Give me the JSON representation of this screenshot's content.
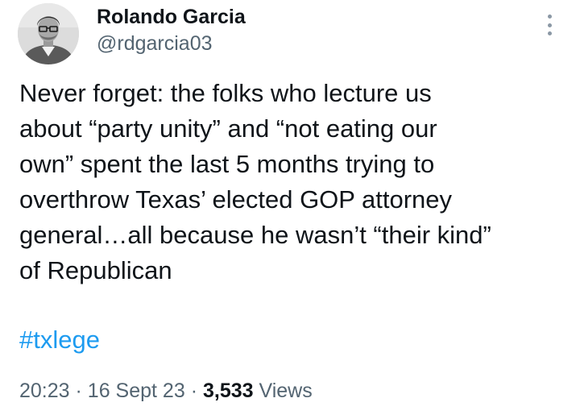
{
  "author": {
    "display_name": "Rolando Garcia",
    "handle": "@rdgarcia03",
    "avatar_icon": "user-avatar-photo"
  },
  "more_icon": "vertical-ellipsis-icon",
  "tweet": {
    "text_lines": [
      "Never forget: the folks who lecture us",
      "about “party unity” and “not eating our",
      "own” spent the last 5 months trying to",
      "overthrow Texas’ elected GOP attorney",
      "general…all because he wasn’t “their kind”",
      "of Republican"
    ],
    "hashtag": "#txlege"
  },
  "meta": {
    "time": "20:23",
    "separator": "·",
    "date": "16 Sept 23",
    "views_count": "3,533",
    "views_label": "Views"
  },
  "colors": {
    "text": "#0f1419",
    "secondary": "#536471",
    "link": "#1d9bf0",
    "background": "#ffffff"
  }
}
